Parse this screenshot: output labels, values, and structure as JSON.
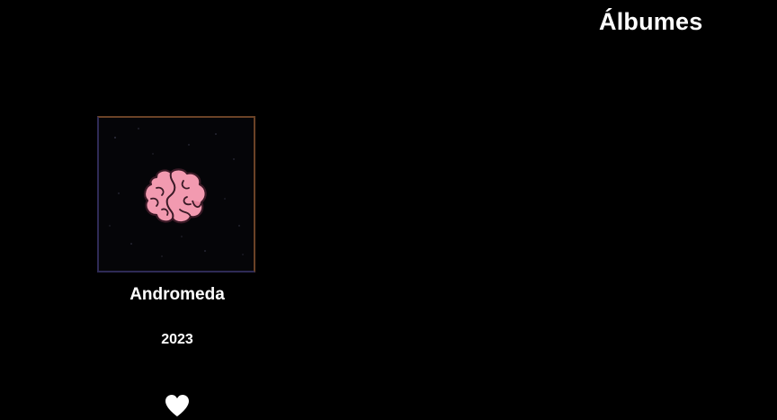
{
  "page": {
    "section_title": "Álbumes"
  },
  "albums": [
    {
      "title": "Andromeda",
      "year": "2023",
      "cover_icon": "brain-icon",
      "like_icon": "heart-icon"
    }
  ],
  "colors": {
    "background": "#000000",
    "text": "#ffffff",
    "brain": "#f29ab0",
    "brain_outline": "#3a1a26",
    "cover_border_warm": "#6a4226",
    "cover_border_cool": "#2e2a55"
  }
}
